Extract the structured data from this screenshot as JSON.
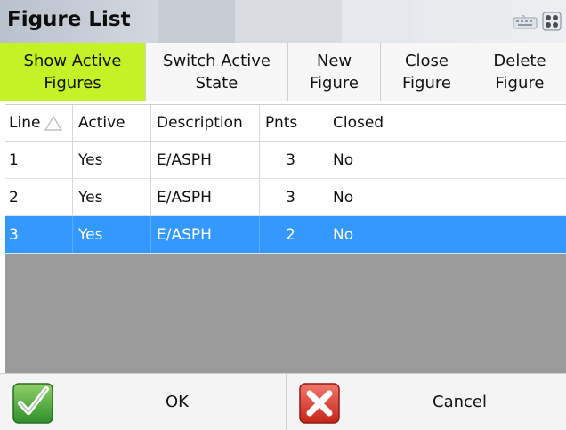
{
  "window": {
    "title": "Figure List"
  },
  "toolbar": {
    "buttons": [
      {
        "label": "Show Active\nFigures",
        "active": true
      },
      {
        "label": "Switch Active\nState",
        "active": false
      },
      {
        "label": "New\nFigure",
        "active": false
      },
      {
        "label": "Close\nFigure",
        "active": false
      },
      {
        "label": "Delete\nFigure",
        "active": false
      }
    ]
  },
  "table": {
    "columns": [
      "Line",
      "Active",
      "Description",
      "Pnts",
      "Closed"
    ],
    "sort_column": "Line",
    "rows": [
      {
        "line": "1",
        "active": "Yes",
        "description": "E/ASPH",
        "pnts": "3",
        "closed": "No",
        "selected": false
      },
      {
        "line": "2",
        "active": "Yes",
        "description": "E/ASPH",
        "pnts": "3",
        "closed": "No",
        "selected": false
      },
      {
        "line": "3",
        "active": "Yes",
        "description": "E/ASPH",
        "pnts": "2",
        "closed": "No",
        "selected": true
      }
    ]
  },
  "footer": {
    "ok_label": "OK",
    "cancel_label": "Cancel"
  },
  "colors": {
    "active_button": "#c3f226",
    "selected_row": "#3399ff",
    "empty_area": "#9b9b9b"
  },
  "icons": {
    "ok": "green-checkmark-icon",
    "cancel": "red-x-icon",
    "titlebar": [
      "keyboard-icon",
      "grid-icon"
    ],
    "sort": "sort-ascending-icon"
  }
}
